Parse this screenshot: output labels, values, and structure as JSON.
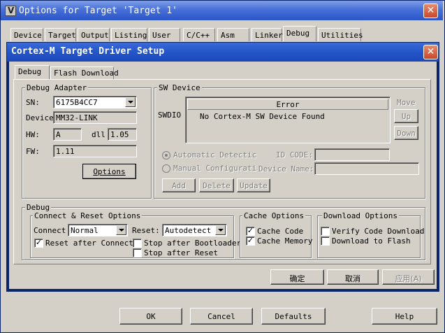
{
  "outer": {
    "title": "Options for Target 'Target 1'",
    "tabs": [
      "Device",
      "Target",
      "Output",
      "Listing",
      "User",
      "C/C++",
      "Asm",
      "Linker",
      "Debug",
      "Utilities"
    ],
    "selected_tab": "Debug",
    "buttons": {
      "ok": "OK",
      "cancel": "Cancel",
      "defaults": "Defaults",
      "help": "Help"
    }
  },
  "dialog": {
    "title": "Cortex-M Target Driver Setup",
    "tabs": [
      "Debug",
      "Flash Download"
    ],
    "selected_tab": "Debug",
    "debug_adapter": {
      "group_label": "Debug Adapter",
      "sn_label": "SN:",
      "sn_value": "6175B4CC7",
      "device_label": "Device",
      "device_value": "MM32-LINK",
      "hw_label": "HW:",
      "hw_value": "A",
      "dll_label": "dll",
      "dll_value": "1.05",
      "fw_label": "FW:",
      "fw_value": "1.11",
      "options_button": "Options"
    },
    "sw_device": {
      "group_label": "SW Device",
      "swdio_label": "SWDIO",
      "column_header": "Error",
      "row_text": "No Cortex-M SW Device Found",
      "move_label": "Move",
      "up_button": "Up",
      "down_button": "Down",
      "auto_detect_label": "Automatic Detectic",
      "manual_config_label": "Manual Configurati",
      "id_code_label": "ID CODE:",
      "device_name_label": "Device Name:",
      "add_button": "Add",
      "delete_button": "Delete",
      "update_button": "Update"
    },
    "debug": {
      "group_label": "Debug",
      "connect_reset": {
        "group_label": "Connect & Reset Options",
        "connect_label": "Connect:",
        "connect_value": "Normal",
        "reset_label": "Reset:",
        "reset_value": "Autodetect",
        "reset_after_connect": "Reset after Connect",
        "stop_after_bootloader": "Stop after Bootloader",
        "stop_after_reset": "Stop after Reset"
      },
      "cache_options": {
        "group_label": "Cache Options",
        "cache_code": "Cache Code",
        "cache_memory": "Cache Memory"
      },
      "download_options": {
        "group_label": "Download Options",
        "verify_code_download": "Verify Code Download",
        "download_to_flash": "Download to Flash"
      }
    },
    "buttons": {
      "ok": "确定",
      "cancel": "取消",
      "apply": "应用(A)"
    }
  }
}
